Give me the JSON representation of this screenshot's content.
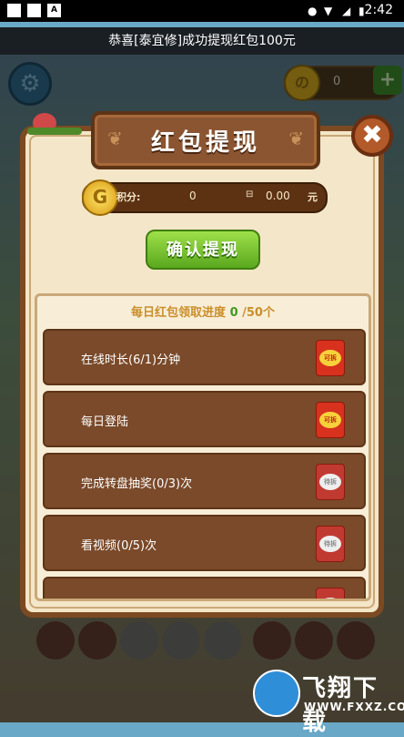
{
  "status_bar": {
    "time": "2:42"
  },
  "notice": {
    "text": "恭喜[泰宜修]成功提现红包100元"
  },
  "hud": {
    "coin_symbol": "の",
    "coin_value": "0",
    "plus": "+"
  },
  "dialog": {
    "title": "红包提现",
    "close_symbol": "✖",
    "score": {
      "coin_letter": "G",
      "label": "积分:",
      "value": "0",
      "equals": "⊟",
      "money": "0.00",
      "unit": "元"
    },
    "confirm_label": "确认提现",
    "progress": {
      "prefix": "每日红包领取进度",
      "count": "0",
      "suffix": "/50个"
    },
    "tasks": [
      {
        "label": "在线时长(6/1)分钟",
        "badge": "可拆",
        "state": "available"
      },
      {
        "label": "每日登陆",
        "badge": "可拆",
        "state": "available"
      },
      {
        "label": "完成转盘抽奖(0/3)次",
        "badge": "待拆",
        "state": "locked"
      },
      {
        "label": "看视频(0/5)次",
        "badge": "待拆",
        "state": "locked"
      },
      {
        "label": "",
        "badge": "",
        "state": "locked"
      }
    ]
  },
  "watermark": {
    "title": "飞翔下载",
    "url": "WWW.FXXZ.COM"
  },
  "colors": {
    "dialog_bg": "#f4e6c8",
    "wood": "#7c4a22",
    "confirm_green": "#5aa81e",
    "envelope_red": "#d8311e"
  }
}
